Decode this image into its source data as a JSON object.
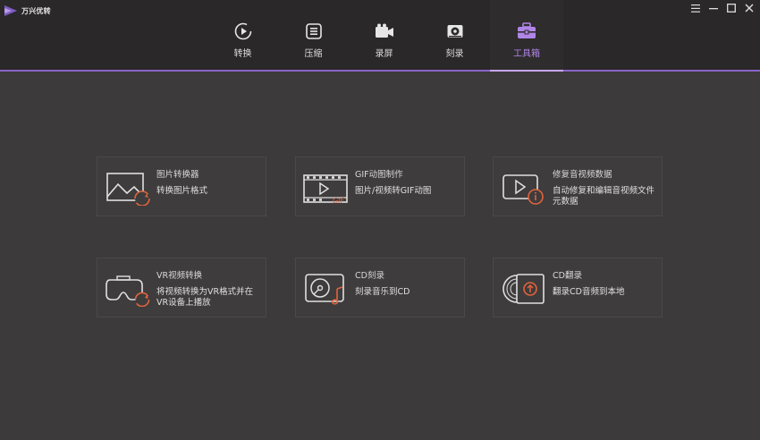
{
  "app": {
    "title": "万兴优转"
  },
  "tabs": [
    {
      "label": "转换",
      "icon": "convert-icon"
    },
    {
      "label": "压缩",
      "icon": "compress-icon"
    },
    {
      "label": "录屏",
      "icon": "screen-record-icon"
    },
    {
      "label": "刻录",
      "icon": "burn-icon"
    },
    {
      "label": "工具箱",
      "icon": "toolbox-icon",
      "active": true
    }
  ],
  "tools": [
    {
      "title": "图片转换器",
      "desc": "转换图片格式"
    },
    {
      "title": "GIF动图制作",
      "desc": "图片/视频转GIF动图"
    },
    {
      "title": "修复音视频数据",
      "desc": "自动修复和编辑音视频文件元数据"
    },
    {
      "title": "VR视频转换",
      "desc": "将视频转换为VR格式并在VR设备上播放"
    },
    {
      "title": "CD刻录",
      "desc": "刻录音乐到CD"
    },
    {
      "title": "CD翻录",
      "desc": "翻录CD音频到本地"
    }
  ],
  "colors": {
    "accent": "#8a63c8",
    "active_label": "#b085e8",
    "icon_accent": "#e0643c"
  },
  "icon_text": {
    "gif": "GIF"
  }
}
